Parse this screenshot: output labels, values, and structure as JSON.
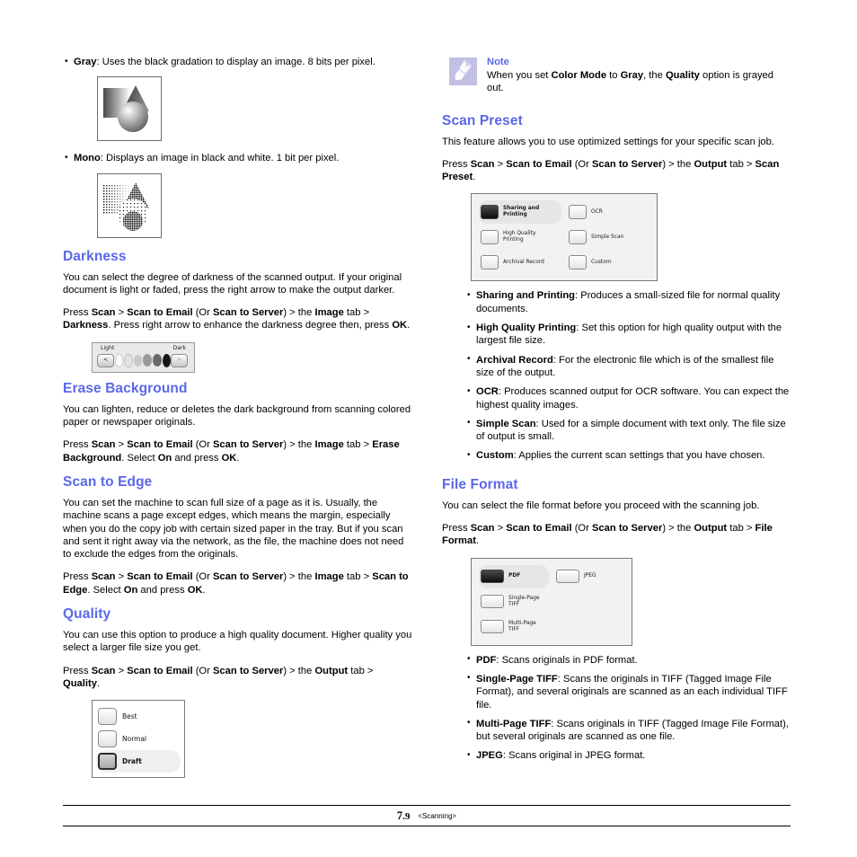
{
  "left_column": {
    "color_mode_bullets": [
      {
        "term": "Gray",
        "text": ": Uses the black gradation to display an image. 8 bits per pixel."
      },
      {
        "term": "Mono",
        "text": ": Displays an image in black and white. 1 bit per pixel."
      }
    ],
    "gray_sample_alt": "gray-gradation-shapes-sample",
    "mono_sample_alt": "mono-halftone-shapes-sample",
    "darkness": {
      "heading": "Darkness",
      "paragraph": "You can select the degree of darkness of the scanned output. If your original document is light or faded, press the right arrow to make the output darker.",
      "press_prefix": "Press ",
      "press_scan": "Scan",
      "press_gt1": " > ",
      "press_scan_to_email": "Scan to Email",
      "press_or_open": " (Or ",
      "press_scan_to_server": "Scan to Server",
      "press_or_close": ") > the ",
      "press_tab": "Image",
      "press_tab_suffix": " tab > ",
      "press_target": "Darkness",
      "press_tail_1": ". Press right arrow to enhance the darkness degree then, press ",
      "press_ok": "OK",
      "press_tail_2": "."
    },
    "darkness_widget": {
      "light_label": "Light",
      "dark_label": "Dark",
      "left_arrow": "<",
      "right_arrow": ">"
    },
    "erase_background": {
      "heading": "Erase Background",
      "paragraph": "You can lighten, reduce or deletes the dark background from scanning colored paper or newspaper originals.",
      "press_target": "Erase Background",
      "press_tail_1": ". Select ",
      "press_on": "On",
      "press_tail_2": " and press ",
      "press_ok": "OK",
      "press_tail_3": "."
    },
    "scan_to_edge": {
      "heading": "Scan to Edge",
      "paragraph": "You can set the machine to scan full size of a page as it is. Usually, the machine scans a page except edges, which means the margin, especially when you do the copy job with certain sized paper in the tray. But if you scan and sent it right away via the network, as the file, the machine does not need to exclude the edges from the originals.",
      "press_target": "Scan to Edge"
    },
    "quality": {
      "heading": "Quality",
      "paragraph": "You can use this option to produce a high quality document. Higher quality you select a larger file size you get.",
      "press_tab": "Output",
      "press_target": "Quality",
      "press_tail": "."
    },
    "quality_widget": {
      "options": [
        {
          "label": "Best",
          "selected": false
        },
        {
          "label": "Normal",
          "selected": false
        },
        {
          "label": "Draft",
          "selected": true
        }
      ]
    }
  },
  "right_column": {
    "note": {
      "icon": "note-pencil-icon",
      "title": "Note",
      "text_part1": "When you set ",
      "bold1": "Color Mode",
      "text_part2": " to ",
      "bold2": "Gray",
      "text_part3": ", the ",
      "bold3": "Quality",
      "text_part4": " option is grayed out."
    },
    "scan_preset": {
      "heading": "Scan Preset",
      "paragraph": "This feature allows you to use optimized settings for your specific scan job.",
      "press_tab": "Output",
      "press_target": "Scan Preset",
      "press_tail": "."
    },
    "scan_preset_widget": {
      "items": [
        {
          "label": "Sharing and\nPrinting",
          "selected": true
        },
        {
          "label": "OCR",
          "selected": false
        },
        {
          "label": "High Quality\nPrinting",
          "selected": false
        },
        {
          "label": "Simple Scan",
          "selected": false
        },
        {
          "label": "Archival Record",
          "selected": false
        },
        {
          "label": "Custom",
          "selected": false
        }
      ]
    },
    "scan_preset_bullets": [
      {
        "term": "Sharing and Printing",
        "text": ": Produces a small-sized file for normal quality documents."
      },
      {
        "term": "High Quality Printing",
        "text": ": Set this option for high quality output with the largest file size."
      },
      {
        "term": "Archival Record",
        "text": ": For the electronic file which is of the smallest file size of the output."
      },
      {
        "term": "OCR",
        "text": ": Produces scanned output for OCR software. You can expect the highest quality images."
      },
      {
        "term": "Simple Scan",
        "text": ": Used for a simple document with text only. The file size of output is small."
      },
      {
        "term": "Custom",
        "text": ": Applies the current scan settings that you have chosen."
      }
    ],
    "file_format": {
      "heading": "File Format",
      "paragraph": "You can select the file format before you proceed with the scanning job.",
      "press_tab": "Output",
      "press_target": "File Format",
      "press_tail": "."
    },
    "file_format_widget": {
      "items": [
        {
          "label": "PDF",
          "selected": true
        },
        {
          "label": "JPEG",
          "selected": false
        },
        {
          "label": "Single-Page\nTIFF",
          "selected": false
        },
        {
          "label": "Multi-Page\nTIFF",
          "selected": false
        }
      ]
    },
    "file_format_bullets": [
      {
        "term": "PDF",
        "text": ": Scans originals in PDF format."
      },
      {
        "term": "Single-Page TIFF",
        "text": ": Scans the originals in TIFF (Tagged Image File Format), and several originals are scanned as an each individual TIFF file."
      },
      {
        "term": "Multi-Page TIFF",
        "text": ": Scans originals in TIFF (Tagged Image File Format), but several originals are scanned as one file."
      },
      {
        "term": "JPEG",
        "text": ": Scans original in JPEG format."
      }
    ]
  },
  "shared": {
    "press_prefix": "Press ",
    "scan": "Scan",
    "gt": " > ",
    "scan_to_email": "Scan to Email",
    "or_open": " (Or ",
    "scan_to_server": "Scan to Server",
    "or_close": ") > the ",
    "image_tab": "Image",
    "tab_suffix": " tab > "
  },
  "footer": {
    "page_major": "7",
    "page_minor": ".9",
    "chapter": "<Scanning>"
  },
  "colors": {
    "heading_blue": "#5a68e8",
    "note_icon_bg": "#c3c0e6",
    "text": "#000000"
  }
}
